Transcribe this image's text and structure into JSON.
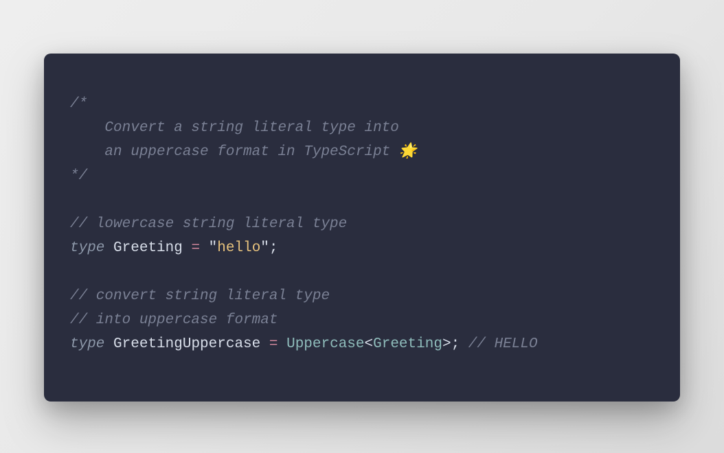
{
  "code": {
    "comment_block_open": "/*",
    "comment_block_line1": "    Convert a string literal type into",
    "comment_block_line2": "    an uppercase format in TypeScript 🌟",
    "comment_block_close": "*/",
    "comment1": "// lowercase string literal type",
    "kw_type1": "type",
    "type_name1": "Greeting",
    "op_eq1": " = ",
    "quote_open1": "\"",
    "string1": "hello",
    "quote_close1": "\"",
    "semi1": ";",
    "comment2": "// convert string literal type",
    "comment3": "// into uppercase format",
    "kw_type2": "type",
    "type_name2": "GreetingUppercase",
    "op_eq2": " = ",
    "util_type": "Uppercase",
    "angle_open": "<",
    "generic_arg": "Greeting",
    "angle_close": ">",
    "semi2": ";",
    "trailing_comment": "// HELLO"
  },
  "colors": {
    "background": "#2a2d3e",
    "comment": "#7a8094",
    "keyword": "#8c97a8",
    "type": "#d8dee9",
    "operator": "#d0879c",
    "string": "#e7c27d",
    "typename": "#8fbcbb"
  }
}
